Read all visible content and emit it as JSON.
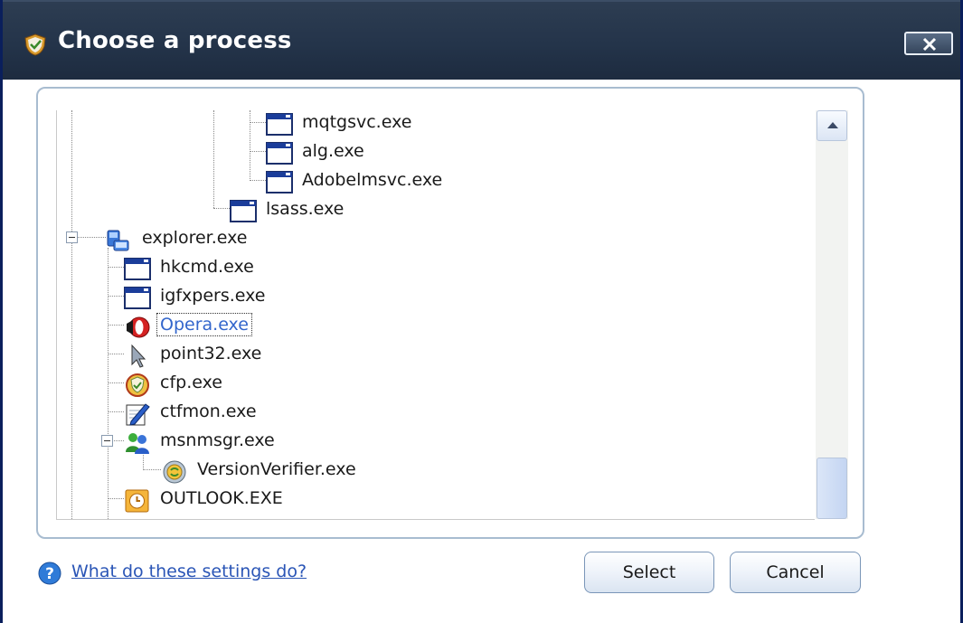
{
  "window": {
    "title": "Choose a process"
  },
  "tree": {
    "nodes": [
      {
        "label": "mqtgsvc.exe",
        "icon": "app-window-icon"
      },
      {
        "label": "alg.exe",
        "icon": "app-window-icon"
      },
      {
        "label": "Adobelmsvc.exe",
        "icon": "app-window-icon"
      },
      {
        "label": "lsass.exe",
        "icon": "app-window-icon"
      },
      {
        "label": "explorer.exe",
        "icon": "computer-icon"
      },
      {
        "label": "hkcmd.exe",
        "icon": "app-window-icon"
      },
      {
        "label": "igfxpers.exe",
        "icon": "app-window-icon"
      },
      {
        "label": "Opera.exe",
        "icon": "opera-icon",
        "selected": true
      },
      {
        "label": "point32.exe",
        "icon": "mouse-pointer-icon"
      },
      {
        "label": "cfp.exe",
        "icon": "comodo-shield-icon"
      },
      {
        "label": "ctfmon.exe",
        "icon": "pen-notepad-icon"
      },
      {
        "label": "msnmsgr.exe",
        "icon": "msn-buddies-icon"
      },
      {
        "label": "VersionVerifier.exe",
        "icon": "version-verifier-icon"
      },
      {
        "label": "OUTLOOK.EXE",
        "icon": "outlook-clock-icon"
      }
    ]
  },
  "footer": {
    "help_link": "What do these settings do?",
    "select_label": "Select",
    "cancel_label": "Cancel"
  },
  "colors": {
    "titlebar": "#24344a",
    "link": "#2a55b6",
    "selected_text": "#3366cc"
  }
}
